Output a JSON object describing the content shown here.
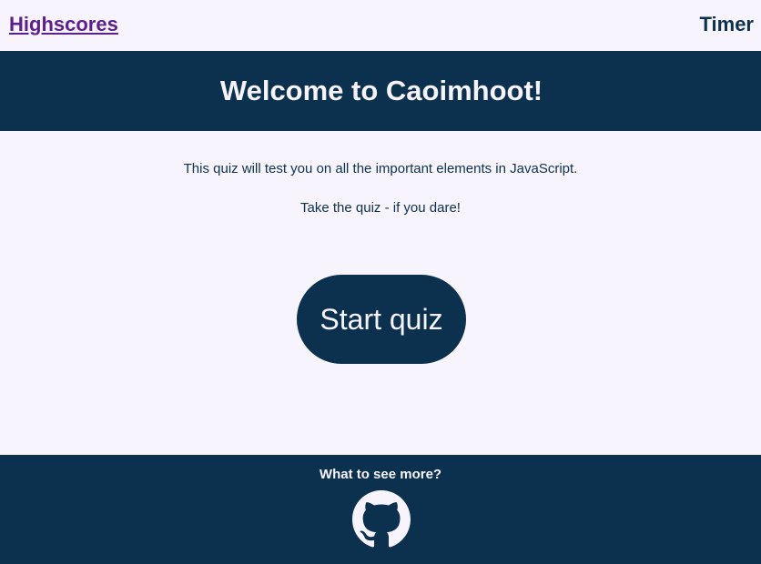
{
  "nav": {
    "highscores_label": "Highscores",
    "timer_label": "Timer"
  },
  "banner": {
    "title": "Welcome to Caoimhoot!"
  },
  "main": {
    "intro_text": "This quiz will test you on all the important elements in JavaScript.",
    "dare_text": "Take the quiz - if you dare!",
    "start_button_label": "Start quiz"
  },
  "footer": {
    "prompt_text": "What to see more?",
    "icon": "github-icon"
  },
  "colors": {
    "primary": "#0c314f",
    "background": "#f8f4fe",
    "link": "#5c1f8e"
  }
}
